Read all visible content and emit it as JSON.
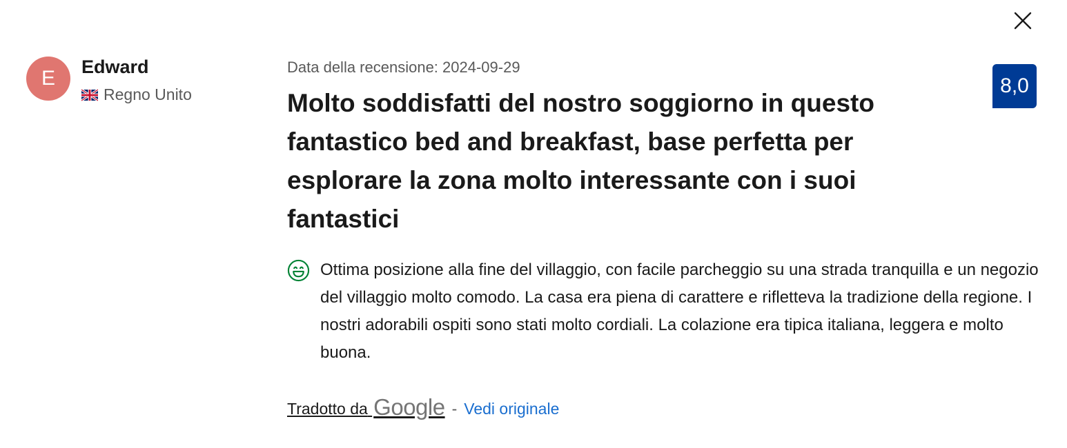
{
  "reviewer": {
    "initial": "E",
    "name": "Edward",
    "country": "Regno Unito",
    "avatar_color": "#e07670"
  },
  "review": {
    "date": "Data della recensione: 2024-09-29",
    "title": "Molto soddisfatti del nostro soggiorno in questo fantastico bed and breakfast, base perfetta per esplorare la zona molto interessante con i suoi fantastici",
    "score": "8,0",
    "score_color": "#003b95",
    "positive": "Ottima posizione alla fine del villaggio, con facile parcheggio su una strada tranquilla e un negozio del villaggio molto comodo. La casa era piena di carattere e rifletteva la tradizione della regione. I nostri adorabili ospiti sono stati molto cordiali. La colazione era tipica italiana, leggera e molto buona."
  },
  "translation": {
    "translated_by": "Tradotto da",
    "provider": "Google",
    "separator": "-",
    "see_original": "Vedi originale",
    "link_color": "#1a6ecf"
  },
  "icons": {
    "close": "close-icon",
    "flag": "uk-flag-icon",
    "positive": "smiley-icon"
  }
}
